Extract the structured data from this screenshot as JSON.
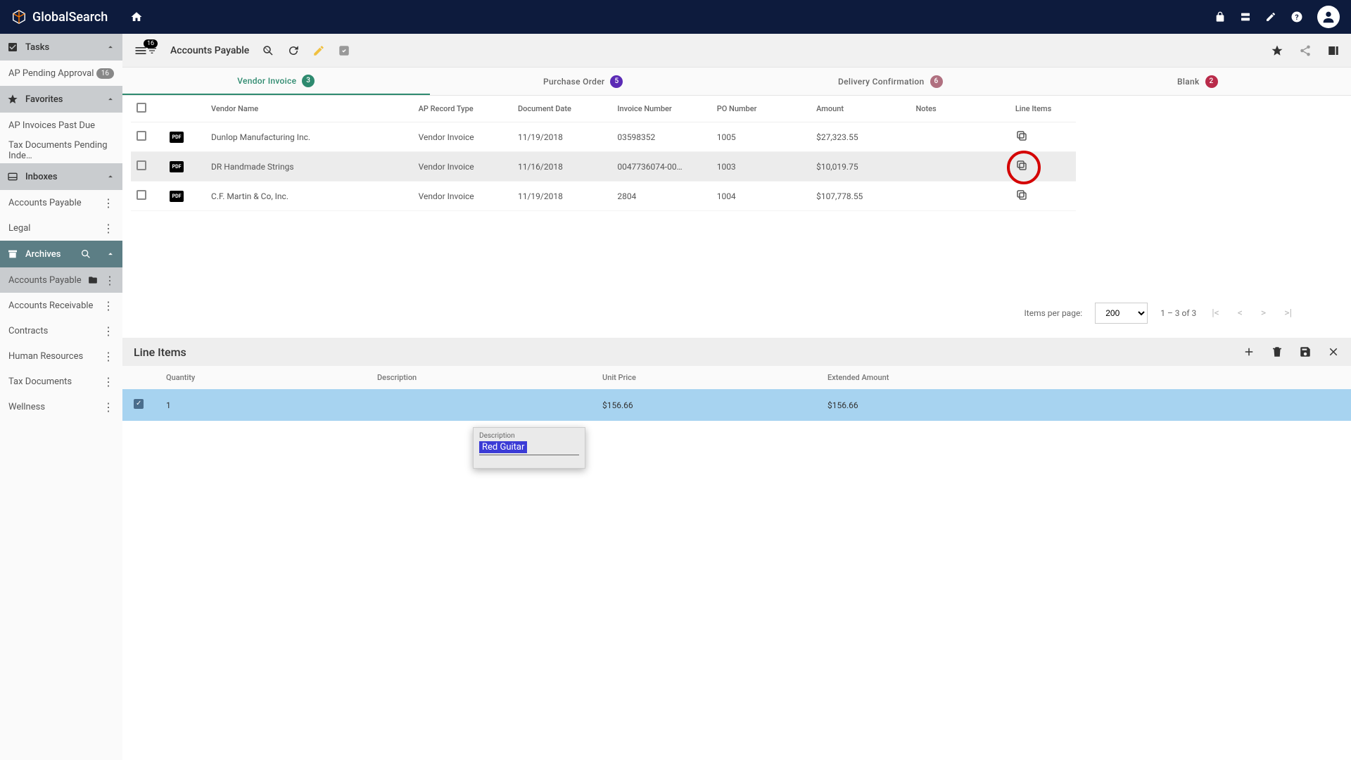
{
  "brand": "GlobalSearch",
  "toolbar": {
    "badge": "16",
    "title": "Accounts Payable"
  },
  "sidebar": {
    "tasks": {
      "label": "Tasks"
    },
    "tasks_items": [
      {
        "label": "AP Pending Approval",
        "badge": "16"
      }
    ],
    "favorites": {
      "label": "Favorites"
    },
    "favorites_items": [
      {
        "label": "AP Invoices Past Due"
      },
      {
        "label": "Tax Documents Pending Inde…"
      }
    ],
    "inboxes": {
      "label": "Inboxes"
    },
    "inboxes_items": [
      {
        "label": "Accounts Payable"
      },
      {
        "label": "Legal"
      }
    ],
    "archives": {
      "label": "Archives"
    },
    "archives_items": [
      {
        "label": "Accounts Payable",
        "active": true
      },
      {
        "label": "Accounts Receivable"
      },
      {
        "label": "Contracts"
      },
      {
        "label": "Human Resources"
      },
      {
        "label": "Tax Documents"
      },
      {
        "label": "Wellness"
      }
    ]
  },
  "tabs": [
    {
      "label": "Vendor Invoice",
      "count": "3",
      "color": "c-teal",
      "active": true
    },
    {
      "label": "Purchase Order",
      "count": "5",
      "color": "c-purple"
    },
    {
      "label": "Delivery Confirmation",
      "count": "6",
      "color": "c-mauve"
    },
    {
      "label": "Blank",
      "count": "2",
      "color": "c-red"
    }
  ],
  "columns": {
    "vendor": "Vendor Name",
    "type": "AP Record Type",
    "date": "Document Date",
    "invoice": "Invoice Number",
    "po": "PO Number",
    "amount": "Amount",
    "notes": "Notes",
    "lineitems": "Line Items"
  },
  "rows": [
    {
      "vendor": "Dunlop Manufacturing Inc.",
      "type": "Vendor Invoice",
      "date": "11/19/2018",
      "invoice": "03598352",
      "po": "1005",
      "amount": "$27,323.55"
    },
    {
      "vendor": "DR Handmade Strings",
      "type": "Vendor Invoice",
      "date": "11/16/2018",
      "invoice": "0047736074-00…",
      "po": "1003",
      "amount": "$10,019.75",
      "selected": true,
      "circled": true
    },
    {
      "vendor": "C.F. Martin & Co, Inc.",
      "type": "Vendor Invoice",
      "date": "11/19/2018",
      "invoice": "2804",
      "po": "1004",
      "amount": "$107,778.55"
    }
  ],
  "pagination": {
    "label": "Items per page:",
    "value": "200",
    "range": "1 – 3 of 3"
  },
  "lineitems": {
    "title": "Line Items",
    "columns": {
      "qty": "Quantity",
      "desc": "Description",
      "price": "Unit Price",
      "ext": "Extended Amount"
    },
    "row": {
      "qty": "1",
      "price": "$156.66",
      "ext": "$156.66"
    }
  },
  "popup": {
    "label": "Description",
    "value": "Red Guitar"
  }
}
